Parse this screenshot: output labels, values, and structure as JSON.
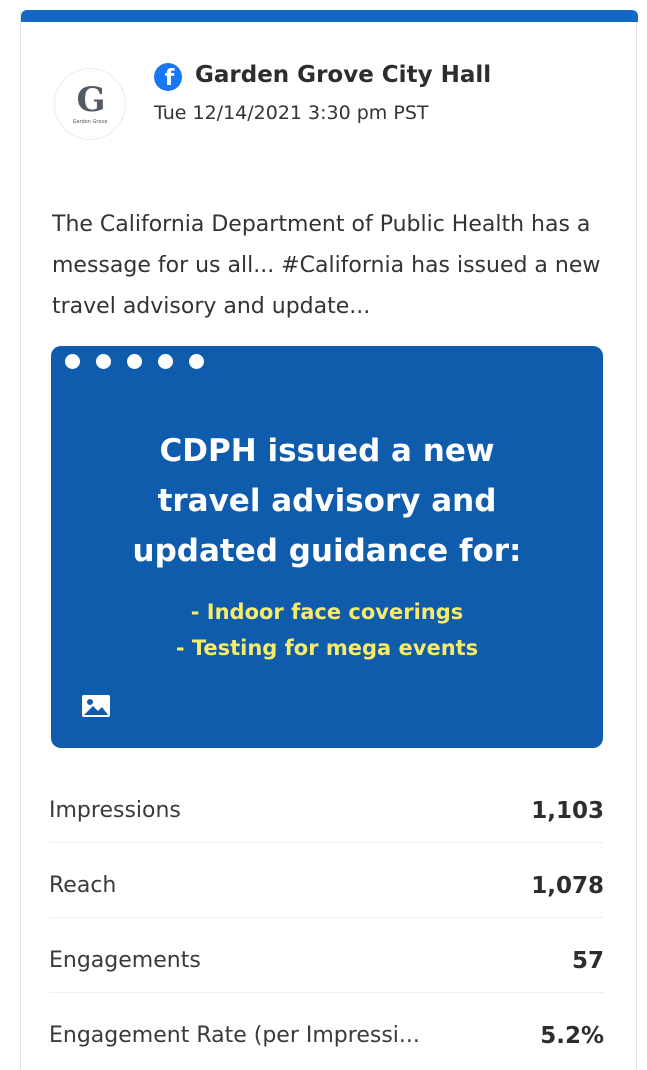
{
  "post": {
    "account_name": "Garden Grove City Hall",
    "avatar": {
      "letter": "G",
      "subtitle": "Garden Grove"
    },
    "platform_icon": "facebook-icon",
    "timestamp": "Tue 12/14/2021 3:30 pm PST",
    "text": "The California Department of Public Health has a message for us all... #California has issued a new travel advisory and update..."
  },
  "image": {
    "headline_lines": [
      "CDPH issued a new",
      "travel advisory and",
      "updated guidance for:"
    ],
    "bullets": [
      "- Indoor face coverings",
      "- Testing for mega events"
    ],
    "carousel_dots": 5,
    "media_type_icon": "image-icon",
    "colors": {
      "background": "#0f5bac",
      "headline": "#ffffff",
      "bullets": "#f4ec6a"
    }
  },
  "metrics": [
    {
      "label": "Impressions",
      "value": "1,103"
    },
    {
      "label": "Reach",
      "value": "1,078"
    },
    {
      "label": "Engagements",
      "value": "57"
    },
    {
      "label": "Engagement Rate (per Impressi...",
      "value": "5.2%"
    }
  ],
  "colors": {
    "accent": "#1469c4",
    "facebook": "#1877f2"
  }
}
